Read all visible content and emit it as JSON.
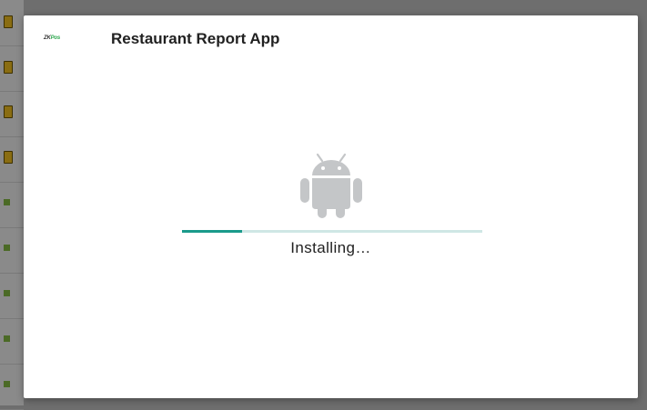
{
  "dialog": {
    "logo_text_part1": "ZK",
    "logo_text_part2": "Pos",
    "title": "Restaurant Report App",
    "status_text": "Installing…",
    "progress": 0.2,
    "icon": "android-robot-icon"
  },
  "colors": {
    "progress_fill": "#1a9a8b",
    "progress_track": "#cfe7e5",
    "android_icon": "#c4c6c8",
    "dialog_background": "#ffffff",
    "backdrop": "#6e6e6e"
  }
}
